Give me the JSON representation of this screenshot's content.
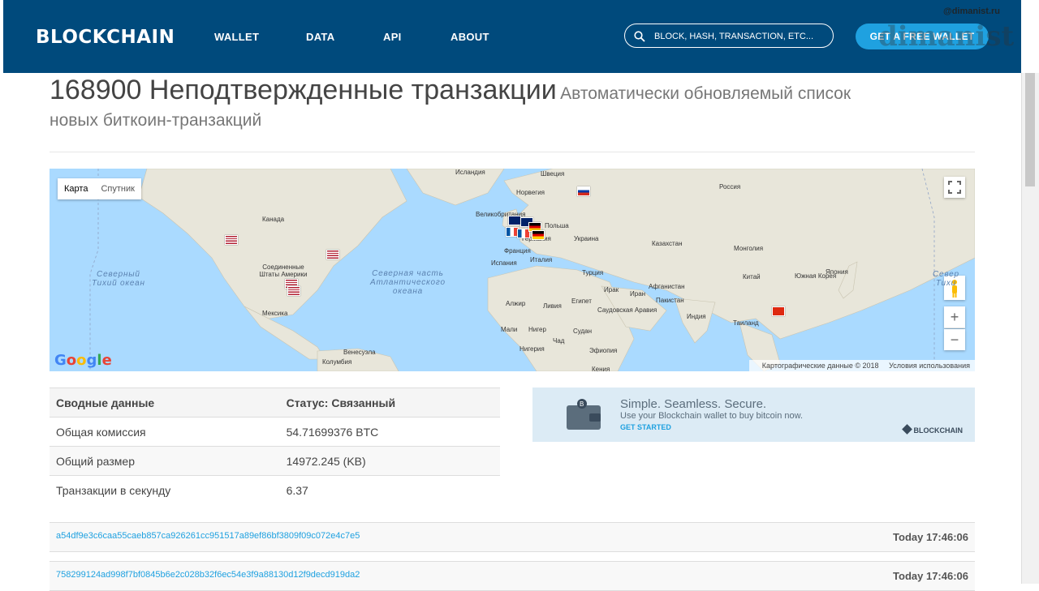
{
  "nav": {
    "logo": "BLOCKCHAIN",
    "links": [
      "WALLET",
      "DATA",
      "API",
      "ABOUT"
    ],
    "search_placeholder": "BLOCK, HASH, TRANSACTION, ETC...",
    "cta": "GET A FREE WALLET",
    "watermark_top": "@dimanist.ru",
    "watermark": "dimanist",
    "bg_color": "#004a7c",
    "accent_color": "#1fa1e0"
  },
  "page": {
    "title_main": "168900 Неподтвержденные транзакции",
    "title_sub_1": "Автоматически обновляемый список",
    "title_sub_2": "новых биткоин-транзакций"
  },
  "map": {
    "type_map": "Карта",
    "type_satellite": "Спутник",
    "zoom_in": "+",
    "zoom_out": "−",
    "attribution": "Картографические данные © 2018",
    "terms": "Условия использования",
    "google_letters": [
      "G",
      "o",
      "o",
      "g",
      "l",
      "e"
    ],
    "google_colors": [
      "#4285f4",
      "#ea4335",
      "#fbbc05",
      "#4285f4",
      "#34a853",
      "#ea4335"
    ],
    "labels": [
      "Исландия",
      "Швеция",
      "Норвегия",
      "Россия",
      "Великобритания",
      "Польша",
      "Канада",
      "Германия",
      "Украина",
      "Казахстан",
      "Монголия",
      "Франция",
      "Италия",
      "Соединенные Штаты Америки",
      "Испания",
      "Турция",
      "Китай",
      "Япония",
      "Южная Корея",
      "Ирак",
      "Иран",
      "Афганистан",
      "Алжир",
      "Ливия",
      "Египет",
      "Пакистан",
      "Мексика",
      "Саудовская Аравия",
      "Индия",
      "Таиланд",
      "Мали",
      "Нигер",
      "Судан",
      "Чад",
      "Нигерия",
      "Эфиопия",
      "Колумбия",
      "Венесуэла",
      "Кения"
    ],
    "oceans": [
      {
        "l1": "Северный",
        "l2": "Тихий океан"
      },
      {
        "l1": "Северная часть",
        "l2": "Атлантического",
        "l3": "океана"
      },
      {
        "l1": "Север",
        "l2": "Тихи"
      }
    ]
  },
  "summary": {
    "header": [
      "Сводные данные",
      "Статус: Связанный"
    ],
    "rows": [
      [
        "Общая комиссия",
        "54.71699376 BTC"
      ],
      [
        "Общий размер",
        "14972.245 (KB)"
      ],
      [
        "Транзакции в секунду",
        "6.37"
      ]
    ]
  },
  "ad": {
    "headline": "Simple. Seamless. Secure.",
    "sub": "Use your Blockchain wallet to buy bitcoin now.",
    "get_started": "GET STARTED",
    "brand": "BLOCKCHAIN"
  },
  "transactions": [
    {
      "hash": "a54df9e3c6caa55caeb857ca926261cc951517a89ef86bf3809f09c072e4c7e5",
      "time": "Today 17:46:06"
    },
    {
      "hash": "758299124ad998f7bf0845b6e2c028b32f6ec54e3f9a88130d12f9decd919da2",
      "time": "Today 17:46:06"
    }
  ]
}
